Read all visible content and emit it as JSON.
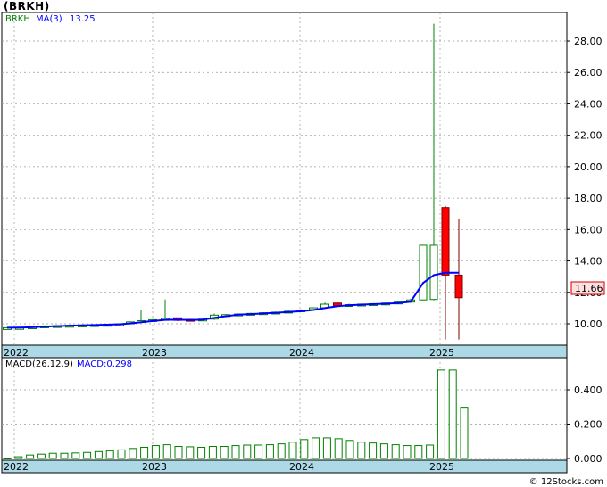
{
  "ticker_title": "(BRKH)",
  "legend": {
    "symbol": "BRKH",
    "ma_label": "MA(3)",
    "ma_value": "13.25",
    "macd_params": "MACD(26,12,9)",
    "macd_value": "MACD:0.298"
  },
  "last_price_label": "11.66",
  "credit": "© 12Stocks.com",
  "colors": {
    "up": "#008000",
    "down": "#ff0000",
    "ma": "#0000ff",
    "axis_bar": "#add8e6",
    "price_tag": "#ffe0e0"
  },
  "chart_data": [
    {
      "type": "candlestick",
      "ylim": [
        9.0,
        29.5
      ],
      "y_ticks": [
        "10.00",
        "12.00",
        "14.00",
        "16.00",
        "18.00",
        "20.00",
        "22.00",
        "24.00",
        "26.00",
        "28.00"
      ],
      "x_ticks": [
        "2022",
        "2023",
        "2024",
        "2025"
      ],
      "grid": true,
      "candles": [
        {
          "i": 0,
          "o": 9.75,
          "h": 9.78,
          "l": 9.72,
          "c": 9.75
        },
        {
          "i": 1,
          "o": 9.75,
          "h": 9.78,
          "l": 9.72,
          "c": 9.76
        },
        {
          "i": 2,
          "o": 9.78,
          "h": 9.82,
          "l": 9.74,
          "c": 9.8
        },
        {
          "i": 3,
          "o": 9.8,
          "h": 9.9,
          "l": 9.78,
          "c": 9.86
        },
        {
          "i": 4,
          "o": 9.86,
          "h": 9.9,
          "l": 9.83,
          "c": 9.88
        },
        {
          "i": 5,
          "o": 9.88,
          "h": 9.92,
          "l": 9.85,
          "c": 9.9
        },
        {
          "i": 6,
          "o": 9.9,
          "h": 9.95,
          "l": 9.87,
          "c": 9.92
        },
        {
          "i": 7,
          "o": 9.92,
          "h": 9.96,
          "l": 9.89,
          "c": 9.94
        },
        {
          "i": 8,
          "o": 9.94,
          "h": 9.98,
          "l": 9.91,
          "c": 9.96
        },
        {
          "i": 9,
          "o": 9.96,
          "h": 10.02,
          "l": 9.93,
          "c": 9.99
        },
        {
          "i": 10,
          "o": 10.0,
          "h": 10.15,
          "l": 9.98,
          "c": 10.12
        },
        {
          "i": 11,
          "o": 10.12,
          "h": 10.85,
          "l": 10.08,
          "c": 10.2
        },
        {
          "i": 12,
          "o": 10.2,
          "h": 10.3,
          "l": 10.15,
          "c": 10.26
        },
        {
          "i": 13,
          "o": 10.26,
          "h": 11.55,
          "l": 10.2,
          "c": 10.35
        },
        {
          "i": 14,
          "o": 10.38,
          "h": 10.4,
          "l": 10.18,
          "c": 10.22
        },
        {
          "i": 15,
          "o": 10.28,
          "h": 10.32,
          "l": 10.22,
          "c": 10.26
        },
        {
          "i": 16,
          "o": 10.26,
          "h": 10.32,
          "l": 10.22,
          "c": 10.3
        },
        {
          "i": 17,
          "o": 10.3,
          "h": 10.65,
          "l": 10.25,
          "c": 10.55
        },
        {
          "i": 18,
          "o": 10.52,
          "h": 10.62,
          "l": 10.48,
          "c": 10.58
        },
        {
          "i": 19,
          "o": 10.58,
          "h": 10.66,
          "l": 10.54,
          "c": 10.62
        },
        {
          "i": 20,
          "o": 10.62,
          "h": 10.7,
          "l": 10.58,
          "c": 10.66
        },
        {
          "i": 21,
          "o": 10.66,
          "h": 10.74,
          "l": 10.62,
          "c": 10.7
        },
        {
          "i": 22,
          "o": 10.7,
          "h": 10.78,
          "l": 10.66,
          "c": 10.74
        },
        {
          "i": 23,
          "o": 10.74,
          "h": 10.84,
          "l": 10.7,
          "c": 10.8
        },
        {
          "i": 24,
          "o": 10.8,
          "h": 10.92,
          "l": 10.76,
          "c": 10.88
        },
        {
          "i": 25,
          "o": 10.9,
          "h": 11.05,
          "l": 10.85,
          "c": 11.02
        },
        {
          "i": 26,
          "o": 11.02,
          "h": 11.35,
          "l": 10.95,
          "c": 11.25
        },
        {
          "i": 27,
          "o": 11.32,
          "h": 11.35,
          "l": 11.12,
          "c": 11.15
        },
        {
          "i": 28,
          "o": 11.15,
          "h": 11.28,
          "l": 11.1,
          "c": 11.22
        },
        {
          "i": 29,
          "o": 11.2,
          "h": 11.3,
          "l": 11.15,
          "c": 11.25
        },
        {
          "i": 30,
          "o": 11.25,
          "h": 11.32,
          "l": 11.2,
          "c": 11.28
        },
        {
          "i": 31,
          "o": 11.28,
          "h": 11.36,
          "l": 11.24,
          "c": 11.32
        },
        {
          "i": 32,
          "o": 11.32,
          "h": 11.42,
          "l": 11.28,
          "c": 11.38
        },
        {
          "i": 33,
          "o": 11.38,
          "h": 11.6,
          "l": 11.34,
          "c": 11.52
        },
        {
          "i": 34,
          "o": 11.52,
          "h": 15.0,
          "l": 11.5,
          "c": 15.0
        },
        {
          "i": 35,
          "o": 11.55,
          "h": 29.1,
          "l": 11.5,
          "c": 15.0
        },
        {
          "i": 36,
          "o": 17.4,
          "h": 17.5,
          "l": 9.0,
          "c": 13.1
        },
        {
          "i": 37,
          "o": 13.1,
          "h": 16.7,
          "l": 9.0,
          "c": 11.66
        }
      ],
      "ma": [
        9.75,
        9.76,
        9.78,
        9.82,
        9.85,
        9.88,
        9.9,
        9.92,
        9.94,
        9.97,
        10.02,
        10.1,
        10.18,
        10.25,
        10.26,
        10.24,
        10.26,
        10.38,
        10.48,
        10.58,
        10.62,
        10.66,
        10.7,
        10.75,
        10.8,
        10.88,
        11.0,
        11.12,
        11.18,
        11.22,
        11.25,
        11.28,
        11.32,
        11.4,
        12.6,
        13.1,
        13.25,
        13.25
      ]
    },
    {
      "type": "bar",
      "series_name": "MACD",
      "ylim": [
        -0.05,
        0.6
      ],
      "y_ticks": [
        "0.000",
        "0.200",
        "0.400"
      ],
      "x_ticks": [
        "2022",
        "2023",
        "2024",
        "2025"
      ],
      "values": [
        0.0,
        0.01,
        0.02,
        0.025,
        0.03,
        0.03,
        0.032,
        0.035,
        0.04,
        0.045,
        0.05,
        0.058,
        0.065,
        0.075,
        0.08,
        0.07,
        0.068,
        0.065,
        0.07,
        0.07,
        0.075,
        0.078,
        0.078,
        0.08,
        0.085,
        0.095,
        0.11,
        0.12,
        0.12,
        0.115,
        0.105,
        0.095,
        0.09,
        0.085,
        0.08,
        0.075,
        0.075,
        0.078,
        0.515,
        0.515,
        0.298
      ]
    }
  ]
}
